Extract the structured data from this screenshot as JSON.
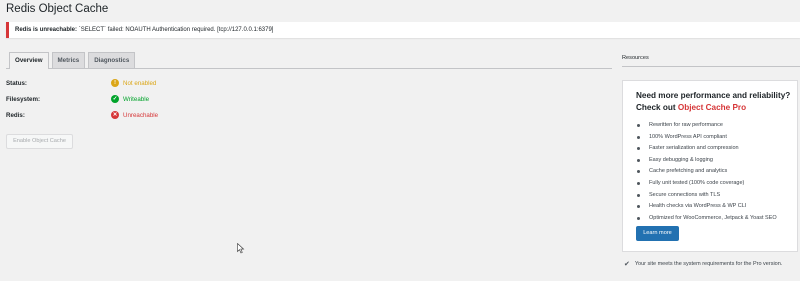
{
  "page": {
    "title": "Redis Object Cache"
  },
  "notice": {
    "strong": "Redis is unreachable:",
    "message": " `SELECT` failed: NOAUTH Authentication required. [tcp://127.0.0.1:6379]"
  },
  "tabs": [
    {
      "label": "Overview",
      "active": true
    },
    {
      "label": "Metrics",
      "active": false
    },
    {
      "label": "Diagnostics",
      "active": false
    }
  ],
  "status": {
    "rows": [
      {
        "label": "Status:",
        "value": "Not enabled",
        "state": "warning"
      },
      {
        "label": "Filesystem:",
        "value": "Writeable",
        "state": "ok"
      },
      {
        "label": "Redis:",
        "value": "Unreachable",
        "state": "error"
      }
    ]
  },
  "actions": {
    "enable_label": "Enable Object Cache"
  },
  "sidebar": {
    "resources_title": "Resources",
    "promo": {
      "headline": "Need more performance and reliability?",
      "checkout_prefix": "Check out ",
      "product": "Object Cache Pro",
      "features": [
        "Rewritten for raw performance",
        "100% WordPress API compliant",
        "Faster serialization and compression",
        "Easy debugging & logging",
        "Cache prefetching and analytics",
        "Fully unit tested (100% code coverage)",
        "Secure connections with TLS",
        "Health checks via WordPress & WP CLI",
        "Optimized for WooCommerce, Jetpack & Yoast SEO"
      ],
      "learn_more": "Learn more"
    },
    "requirements": "Your site meets the system requirements for the Pro version."
  },
  "colors": {
    "accent": "#2271b1",
    "error": "#d63638",
    "warning": "#dba617",
    "success": "#00a32a",
    "background": "#f1f1f1"
  },
  "icons": {
    "warning": "exclamation-circle-icon",
    "ok": "check-circle-icon",
    "error": "x-circle-icon",
    "requirements": "checkmark-icon"
  }
}
